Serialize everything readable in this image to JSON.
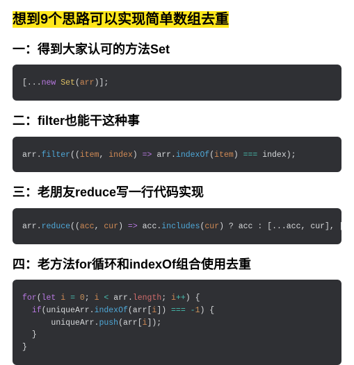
{
  "title": "想到9个思路可以实现简单数组去重",
  "sections": [
    {
      "heading": "一：得到大家认可的方法Set"
    },
    {
      "heading": "二：filter也能干这种事"
    },
    {
      "heading": "三：老朋友reduce写一行代码实现"
    },
    {
      "heading": "四：老方法for循环和indexOf组合使用去重"
    }
  ],
  "code": {
    "s1": {
      "open": "[...",
      "new": "new",
      "sp1": " ",
      "Set": "Set",
      "lp": "(",
      "arr": "arr",
      "rp": ")",
      "close": "];"
    },
    "s2": {
      "arr": "arr",
      "dot1": ".",
      "filter": "filter",
      "lp1": "((",
      "item": "item",
      "comma": ", ",
      "index": "index",
      "rp1": ") ",
      "arrow": "=>",
      "sp": " ",
      "arr2": "arr",
      "dot2": ".",
      "indexOf": "indexOf",
      "lp2": "(",
      "item2": "item",
      "rp2": ") ",
      "eqeq": "===",
      "sp2": " ",
      "index2": "index",
      "end": ");"
    },
    "s3": {
      "arr": "arr",
      "dot1": ".",
      "reduce": "reduce",
      "lp1": "((",
      "acc": "acc",
      "comma": ", ",
      "cur": "cur",
      "rp1": ") ",
      "arrow": "=>",
      "sp": " ",
      "acc2": "acc",
      "dot2": ".",
      "includes": "includes",
      "lp2": "(",
      "cur2": "cur",
      "rp2": ") ",
      "q": "?",
      "sp2": " ",
      "acc3": "acc",
      "colon": " : ",
      "spread": "[...",
      "acc4": "acc",
      "comma2": ", ",
      "cur3": "cur",
      "close": "], ",
      "empty": "[]",
      "end": ");"
    },
    "s4": {
      "for": "for",
      "lp": "(",
      "let": "let",
      "sp1": " ",
      "i1": "i",
      "sp2": " ",
      "eq": "=",
      "sp3": " ",
      "zero": "0",
      "semi1": "; ",
      "i2": "i",
      "sp4": " ",
      "lt": "<",
      "sp5": " ",
      "arr1": "arr",
      "dot1": ".",
      "length": "length",
      "semi2": "; ",
      "i3": "i",
      "inc": "++",
      "rp": ") {",
      "if": "if",
      "lp2": "(",
      "ua1": "uniqueArr",
      "dot2": ".",
      "indexOf": "indexOf",
      "lp3": "(",
      "arr2": "arr",
      "lb1": "[",
      "i4": "i",
      "rb1": "]) ",
      "eqeq": "===",
      "sp6": " ",
      "neg": "-",
      "one": "1",
      "rp2": ") {",
      "ua2": "uniqueArr",
      "dot3": ".",
      "push": "push",
      "lp4": "(",
      "arr3": "arr",
      "lb2": "[",
      "i5": "i",
      "rb2": "]);",
      "close1": "}",
      "close2": "}"
    }
  }
}
